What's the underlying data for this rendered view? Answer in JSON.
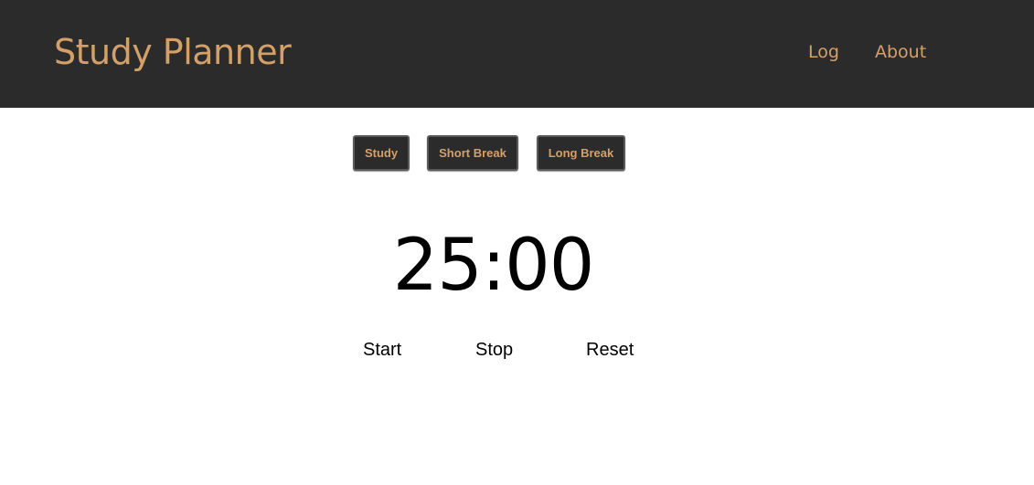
{
  "header": {
    "title": "Study Planner",
    "nav": {
      "log": "Log",
      "about": "About"
    }
  },
  "modes": {
    "study": "Study",
    "short_break": "Short Break",
    "long_break": "Long Break"
  },
  "timer": {
    "display": "25:00"
  },
  "controls": {
    "start": "Start",
    "stop": "Stop",
    "reset": "Reset"
  },
  "colors": {
    "header_bg": "#2c2b2b",
    "accent": "#d4a06a",
    "page_bg": "#ffffff",
    "text": "#000000"
  }
}
